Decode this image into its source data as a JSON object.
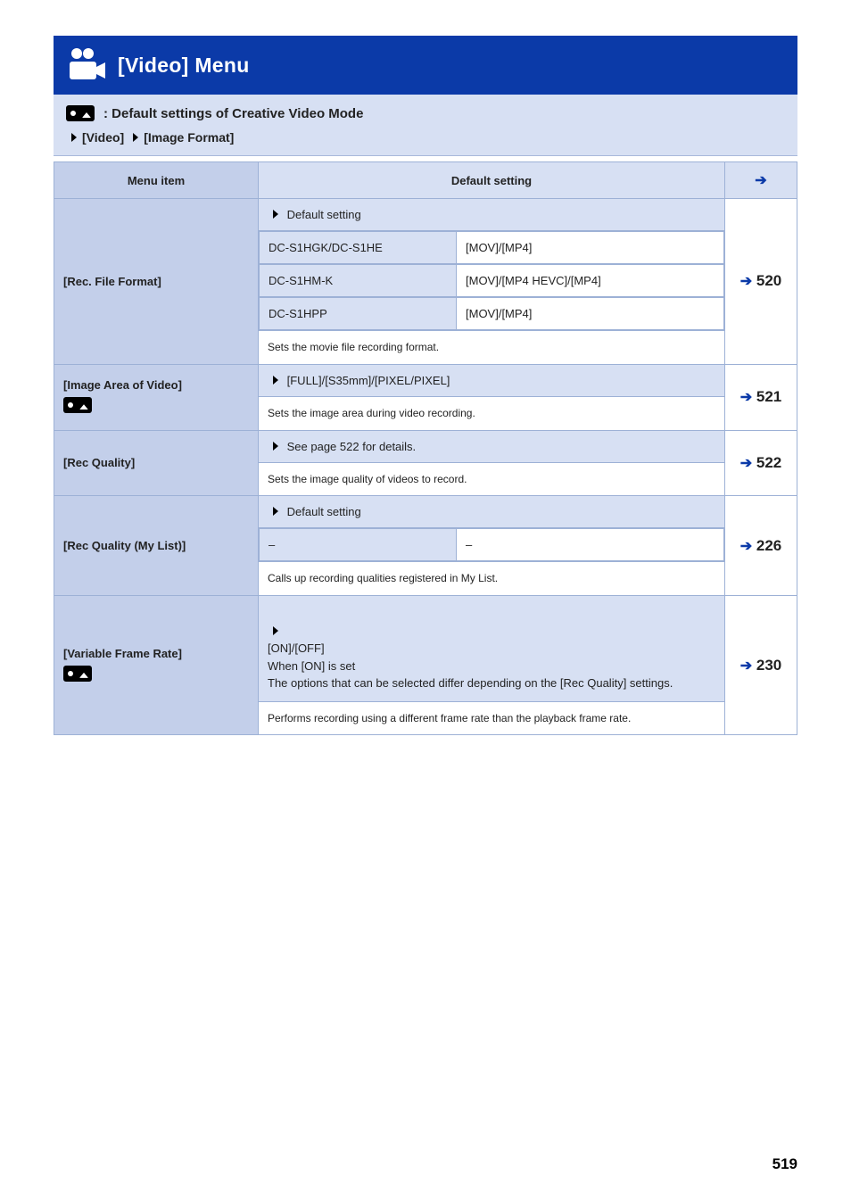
{
  "header": {
    "title": "[Video] Menu"
  },
  "intro": {
    "mode_label": " : Default settings of Creative Video Mode",
    "breadcrumb_left": "[Video]",
    "breadcrumb_right": "[Image Format]"
  },
  "table_head": {
    "item": "Menu item",
    "default": "Default setting",
    "ref": "Refer to"
  },
  "rows": [
    {
      "item": "[Rec. File Format]",
      "ref": "520",
      "default_label": "Default setting",
      "defaults": [
        {
          "left": "DC-S1HGK/DC-S1HE",
          "right": "[MOV]/[MP4]"
        },
        {
          "left": "DC-S1HM-K",
          "right": "[MOV]/[MP4 HEVC]/[MP4]"
        },
        {
          "left": "DC-S1HPP",
          "right": "[MOV]/[MP4]"
        }
      ],
      "desc": "Sets the movie file recording format."
    },
    {
      "item": "[Image Area of Video]",
      "mode_icon": true,
      "ref": "521",
      "default_label": "[FULL]/[S35mm]/[PIXEL/PIXEL]",
      "desc": "Sets the image area during video recording."
    },
    {
      "item": "[Rec Quality]",
      "ref": "522",
      "default_label": "See page 522 for details.",
      "desc": "Sets the image quality of videos to record."
    },
    {
      "item": "[Rec Quality (My List)]",
      "ref": "226",
      "default_label": "Default setting",
      "defaults_simple": {
        "left": "–",
        "right": "–"
      },
      "desc": "Calls up recording qualities registered in My List."
    },
    {
      "item": "[Variable Frame Rate]",
      "mode_icon": true,
      "ref": "230",
      "default_label": "[ON]/[OFF]\nWhen [ON] is set\nThe options that can be selected differ depending on the [Rec Quality] settings.",
      "desc": "Performs recording using a different frame rate than the playback frame rate."
    }
  ],
  "page_number": "519"
}
